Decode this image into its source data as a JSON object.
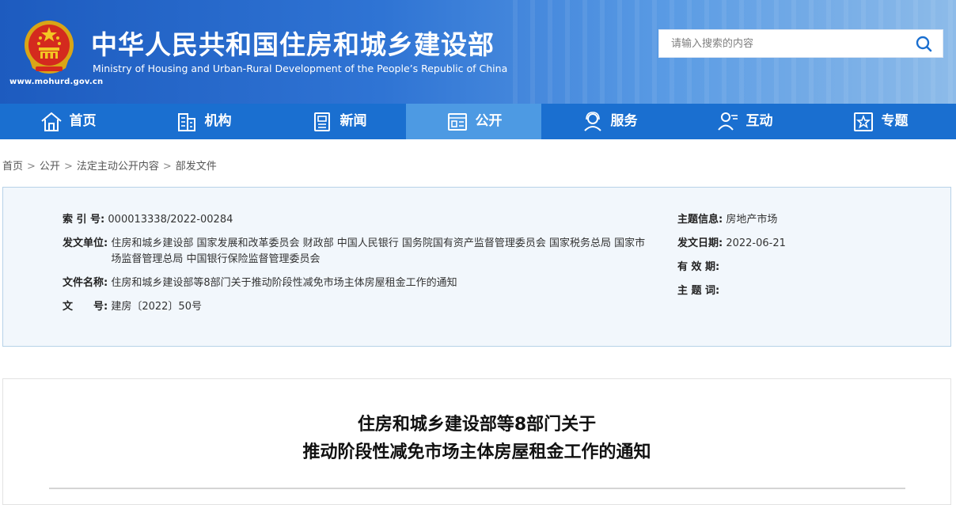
{
  "header": {
    "title_cn": "中华人民共和国住房和城乡建设部",
    "title_en": "Ministry of Housing and Urban-Rural Development of the People’s Republic of China",
    "site_url": "www.mohurd.gov.cn",
    "search_placeholder": "请输入搜索的内容"
  },
  "nav": {
    "items": [
      {
        "label": "首页",
        "icon": "home-icon"
      },
      {
        "label": "机构",
        "icon": "building-icon"
      },
      {
        "label": "新闻",
        "icon": "news-icon"
      },
      {
        "label": "公开",
        "icon": "document-icon",
        "active": true
      },
      {
        "label": "服务",
        "icon": "service-icon"
      },
      {
        "label": "互动",
        "icon": "interaction-icon"
      },
      {
        "label": "专题",
        "icon": "star-icon"
      }
    ]
  },
  "breadcrumb": [
    "首页",
    "公开",
    "法定主动公开内容",
    "部发文件"
  ],
  "meta": {
    "index_label": "索 引 号:",
    "index_value": "000013338/2022-00284",
    "issuer_label": "发文单位:",
    "issuer_value_line1": "住房和城乡建设部 国家发展和改革委员会 财政部 中国人民银行 国务院国有资产监督管理委员会 国家税务总局 国家市",
    "issuer_value_line2": "场监督管理总局 中国银行保险监督管理委员会",
    "filename_label": "文件名称:",
    "filename_value": "住房和城乡建设部等8部门关于推动阶段性减免市场主体房屋租金工作的通知",
    "docno_label": "文　　号:",
    "docno_value": "建房〔2022〕50号",
    "topic_label": "主题信息:",
    "topic_value": "房地产市场",
    "date_label": "发文日期:",
    "date_value": "2022-06-21",
    "valid_label": "有 效 期:",
    "keyword_label": "主 题 词:"
  },
  "article": {
    "title_line1": "住房和城乡建设部等8部门关于",
    "title_line2": "推动阶段性减免市场主体房屋租金工作的通知"
  },
  "colors": {
    "nav_bg": "#1a6fd0",
    "nav_active": "#4d9ae3",
    "meta_bg": "#f2f7fc",
    "meta_border": "#b7d2e8"
  }
}
